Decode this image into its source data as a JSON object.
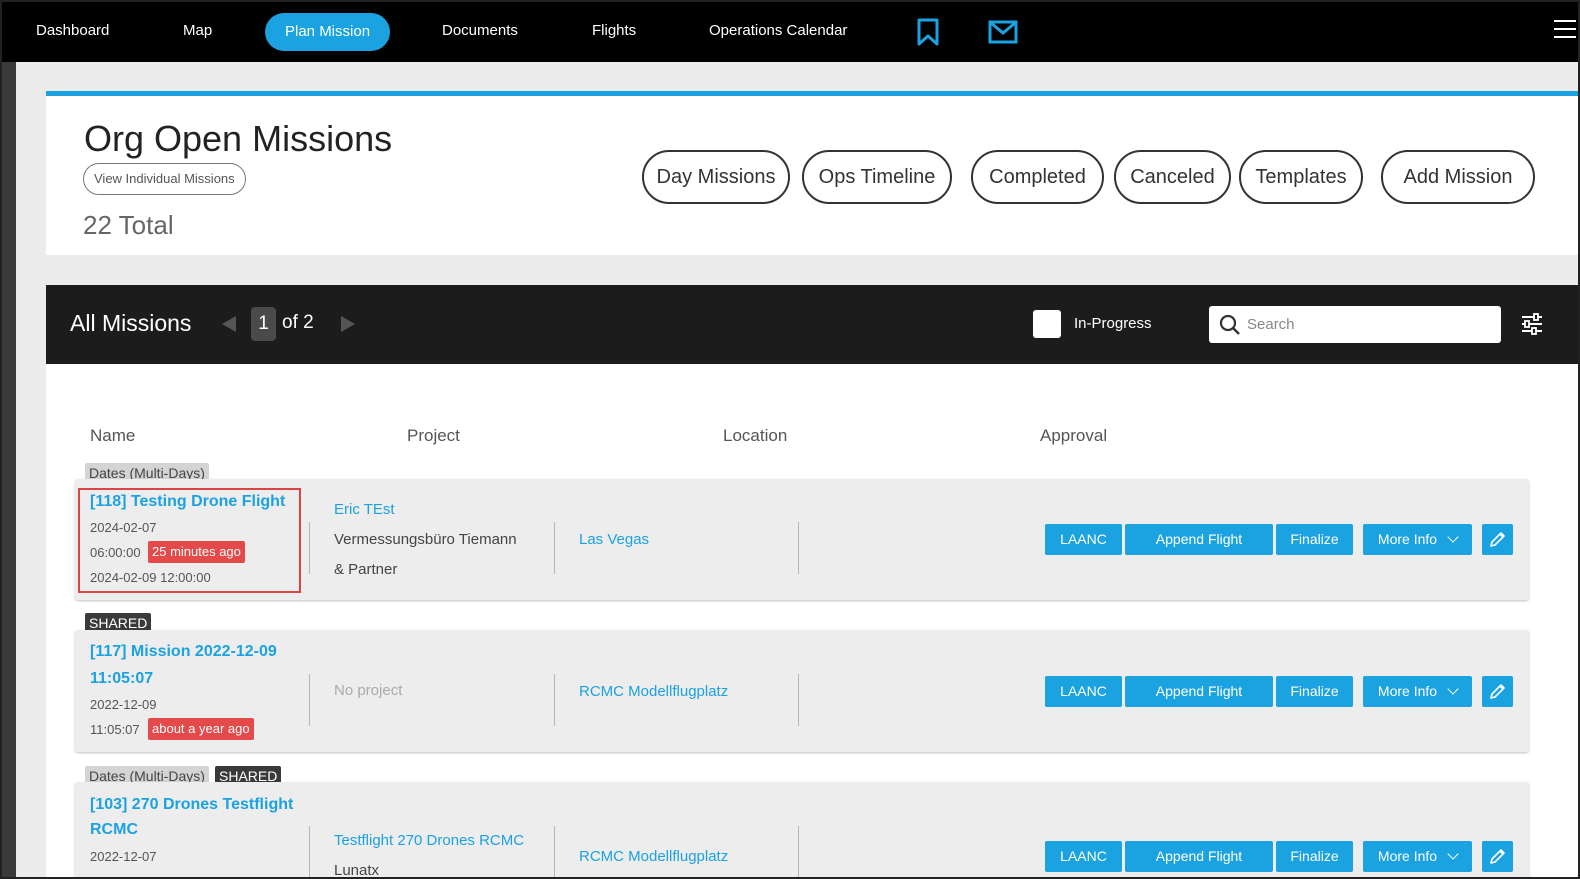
{
  "nav": {
    "items": [
      "Dashboard",
      "Map",
      "Plan Mission",
      "Documents",
      "Flights",
      "Operations Calendar"
    ],
    "active": "Plan Mission"
  },
  "header": {
    "title": "Org Open Missions",
    "view_individual": "View Individual Missions",
    "total": "22 Total",
    "buttons": [
      "Day Missions",
      "Ops Timeline",
      "Completed",
      "Canceled",
      "Templates",
      "Add Mission"
    ]
  },
  "missions_bar": {
    "title": "All Missions",
    "page": "1",
    "page_of": "of 2",
    "in_progress_label": "In-Progress",
    "search_placeholder": "Search"
  },
  "table": {
    "columns": [
      "Name",
      "Project",
      "Location",
      "Approval"
    ],
    "rows": [
      {
        "tags": [
          "Dates (Multi-Days)"
        ],
        "title_lines": [
          "[118] Testing Drone Flight"
        ],
        "date_line": "2024-02-07",
        "time_line": "06:00:00",
        "ago": "25 minutes ago",
        "end_line": "2024-02-09 12:00:00",
        "project_link": "Eric TEst",
        "project_lines": [
          "Vermessungsbüro Tiemann",
          "& Partner"
        ],
        "location": "Las Vegas"
      },
      {
        "tags": [
          "SHARED"
        ],
        "title_lines": [
          "[117] Mission 2022-12-09",
          "11:05:07"
        ],
        "date_line": "2022-12-09",
        "time_line": "11:05:07",
        "ago": "about a year ago",
        "project_none": "No project",
        "location": "RCMC Modellflugplatz"
      },
      {
        "tags": [
          "Dates (Multi-Days)",
          "SHARED"
        ],
        "title_lines": [
          "[103] 270 Drones Testflight",
          "RCMC"
        ],
        "date_line": "2022-12-07",
        "project_link": "Testflight 270 Drones RCMC",
        "project_lines": [
          "Lunatx"
        ],
        "location": "RCMC Modellflugplatz"
      }
    ],
    "actions": {
      "laanc": "LAANC",
      "append": "Append Flight",
      "finalize": "Finalize",
      "more_info": "More Info"
    }
  },
  "colors": {
    "accent": "#1ba2e0",
    "nav_bg": "#000000",
    "ago_badge": "#e44a4a",
    "highlight": "#d94444"
  }
}
